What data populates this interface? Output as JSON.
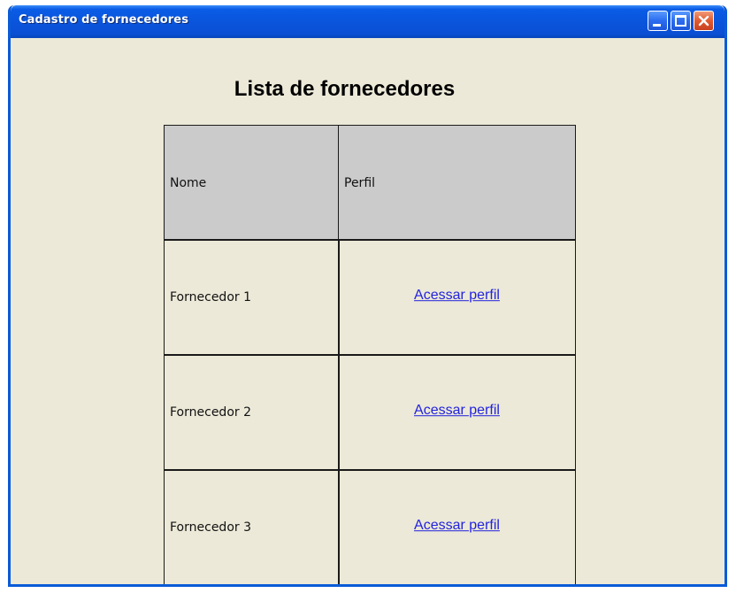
{
  "window": {
    "title": "Cadastro de fornecedores",
    "buttons": [
      "minimize",
      "maximize",
      "close"
    ]
  },
  "page": {
    "heading": "Lista de fornecedores"
  },
  "table": {
    "headers": [
      "Nome",
      "Perfil"
    ],
    "rows": [
      {
        "name": "Fornecedor 1",
        "link": "Acessar perfil"
      },
      {
        "name": "Fornecedor 2",
        "link": "Acessar perfil"
      },
      {
        "name": "Fornecedor 3",
        "link": "Acessar perfil"
      }
    ]
  },
  "colors": {
    "titlebar": "#0a55dc",
    "background": "#ece9d8",
    "header_cell": "#cbcbcb",
    "link": "#2222dd",
    "close_button": "#e05a30"
  }
}
